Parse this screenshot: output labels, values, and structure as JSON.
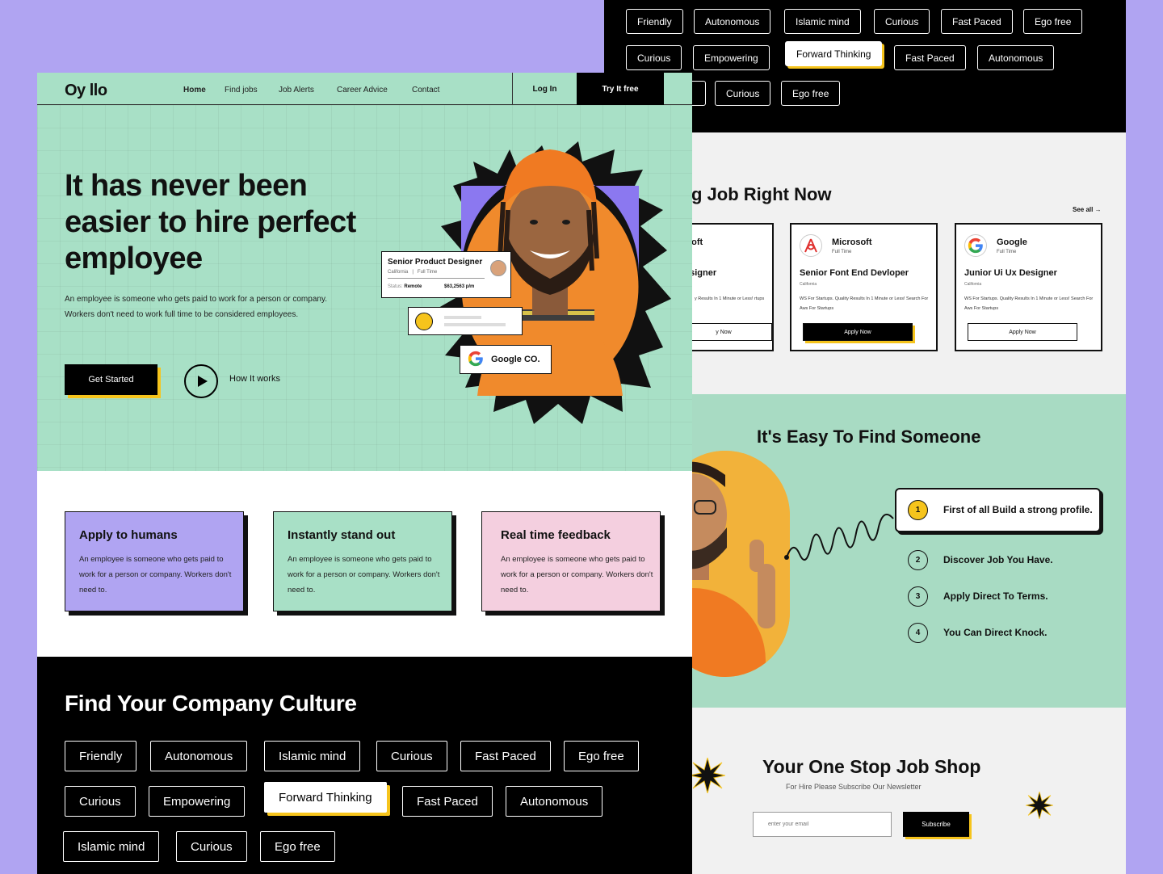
{
  "back": {
    "tags_row1": [
      "Friendly",
      "Autonomous",
      "Islamic mind",
      "Curious",
      "Fast Paced",
      "Ego free"
    ],
    "tags_row2": [
      "Curious",
      "Empowering",
      "Forward Thinking",
      "Fast Paced",
      "Autonomous"
    ],
    "tags_row3": [
      "d",
      "Curious",
      "Ego free"
    ],
    "jobs_title": "g Job Right Now",
    "see_all": "See all",
    "cards": [
      {
        "company": "soft",
        "type": "",
        "role": "esigner",
        "location": "",
        "desc": "y Results In 1 Minute or Less! rtups",
        "apply": "y Now"
      },
      {
        "company": "Microsoft",
        "type": "Full Time",
        "role": "Senior Font End Devloper",
        "location": "California",
        "desc": "WS For Startups. Quality Results In 1 Minute or Less! Search For Aws For Startups",
        "apply": "Apply Now"
      },
      {
        "company": "Google",
        "type": "Full Time",
        "role": "Junior Ui Ux Designer",
        "location": "California",
        "desc": "WS For Startups. Quality Results In 1 Minute or Less! Search For Aws For Startups",
        "apply": "Apply Now"
      }
    ],
    "easy_title": "It's Easy To Find Someone",
    "steps": [
      {
        "num": "1",
        "text": "First of all Build a strong profile."
      },
      {
        "num": "2",
        "text": "Discover Job You Have."
      },
      {
        "num": "3",
        "text": "Apply Direct To Terms."
      },
      {
        "num": "4",
        "text": "You Can Direct Knock."
      }
    ],
    "shop_title": "Your One Stop Job Shop",
    "shop_sub": "For Hire Please Subscribe Our Newsletter",
    "email_placeholder": "enter your email",
    "subscribe": "Subscribe"
  },
  "front": {
    "brand": "Oy llo",
    "nav": [
      "Home",
      "Find jobs",
      "Job Alerts",
      "Career Advice",
      "Contact"
    ],
    "login": "Log In",
    "try_free": "Try It free",
    "hero_title": "It has never been easier to hire perfect employee",
    "hero_desc": "An employee is someone who gets paid to work for a person or company. Workers don't need to work full time to be considered employees.",
    "get_started": "Get Started",
    "how_it_works": "How It works",
    "profile_card": {
      "title": "Senior Product Designer",
      "location": "California",
      "type": "Full Time",
      "status_label": "Status:",
      "status": "Remote",
      "pay": "$63,2563 p/m"
    },
    "google_card": "Google CO.",
    "features": [
      {
        "title": "Apply to humans",
        "desc": "An employee is someone who gets paid to work for a person or company. Workers don't need to.",
        "color": "#b0a4f2"
      },
      {
        "title": "Instantly stand out",
        "desc": "An employee is someone who gets paid to work for a person or company. Workers don't need to.",
        "color": "#a8e0c6"
      },
      {
        "title": "Real time feedback",
        "desc": "An employee is someone who gets paid to work for a person or company. Workers don't need to.",
        "color": "#f4cfdf"
      }
    ],
    "culture_title": "Find Your Company Culture",
    "culture_row1": [
      "Friendly",
      "Autonomous",
      "Islamic mind",
      "Curious",
      "Fast Paced",
      "Ego free"
    ],
    "culture_row2": [
      "Curious",
      "Empowering",
      "Forward Thinking",
      "Fast Paced",
      "Autonomous"
    ],
    "culture_row3": [
      "Islamic mind",
      "Curious",
      "Ego free"
    ]
  },
  "colors": {
    "mint": "#a8e0c6",
    "lavender": "#b0a4f2",
    "pink": "#f4cfdf",
    "yellow": "#f6c41c",
    "orange": "#f08a2c",
    "purple": "#8b78f0"
  }
}
